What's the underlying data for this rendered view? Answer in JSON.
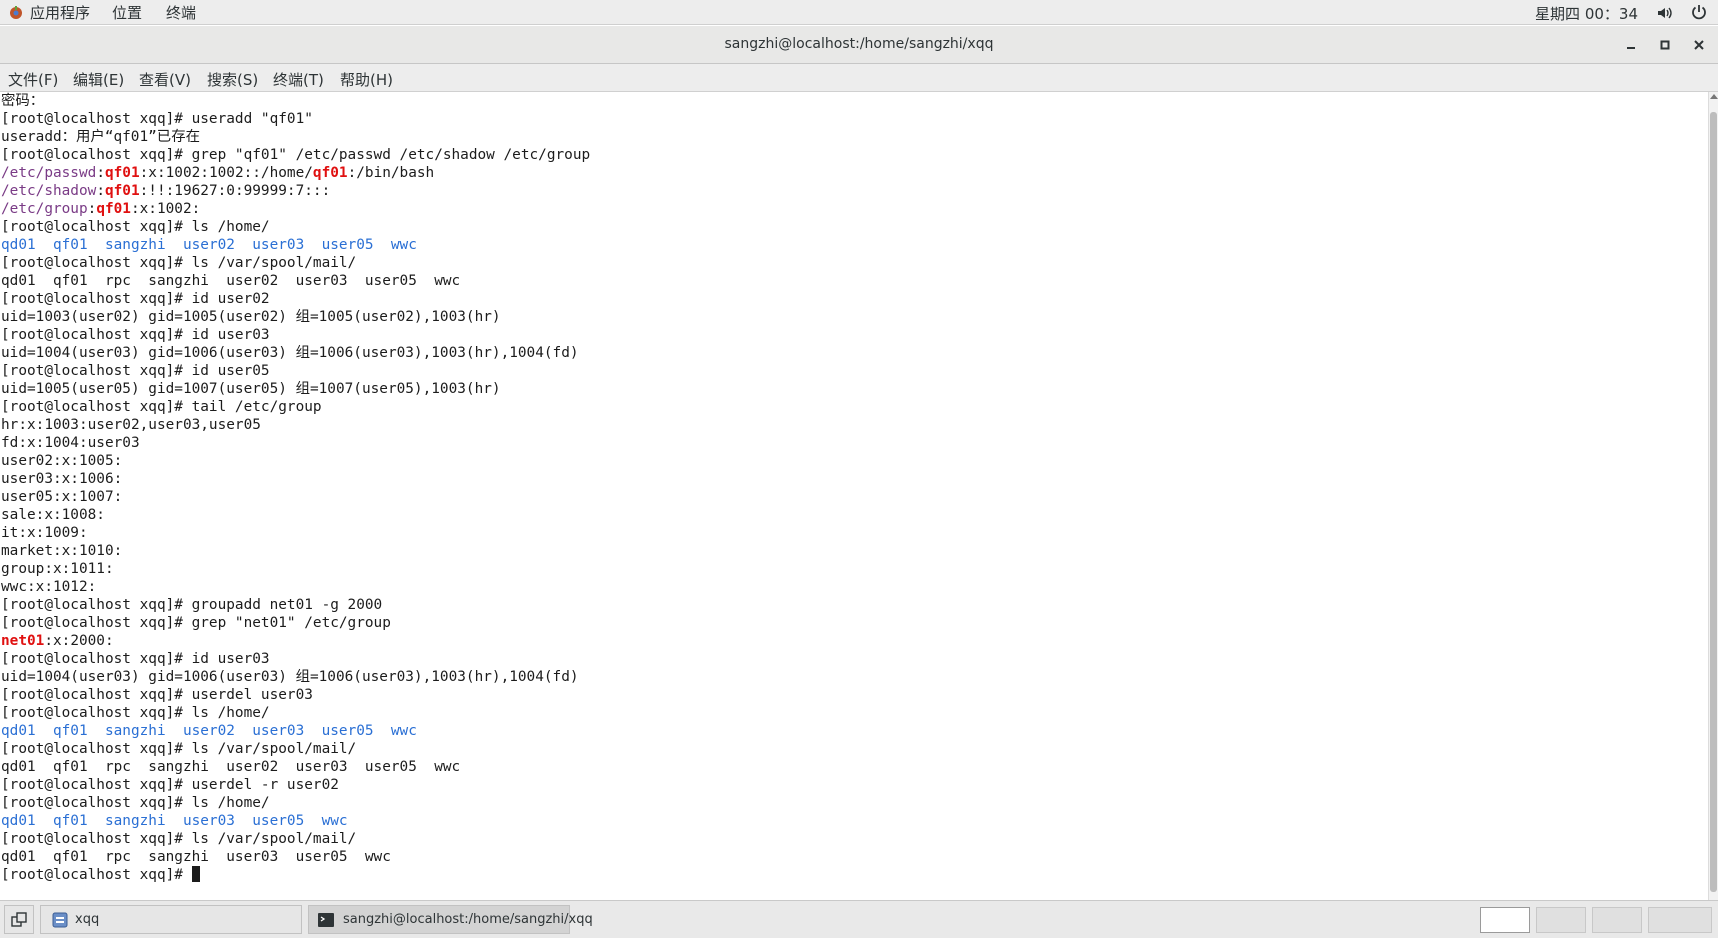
{
  "topbar": {
    "menus": [
      "应用程序",
      "位置",
      "终端"
    ],
    "clock": "星期四 00：34",
    "icons": [
      "apps-icon",
      "volume-icon",
      "power-icon"
    ]
  },
  "window": {
    "title": "sangzhi@localhost:/home/sangzhi/xqq",
    "controls": [
      "minimize-icon",
      "maximize-icon",
      "close-icon"
    ]
  },
  "menubar": [
    "文件(F)",
    "编辑(E)",
    "查看(V)",
    "搜索(S)",
    "终端(T)",
    "帮助(H)"
  ],
  "terminal": {
    "colors": {
      "directory": "#2a6fd4",
      "filename": "#7a3b86",
      "match": "#e01010"
    },
    "lines": [
      [
        {
          "t": "密码："
        }
      ],
      [
        {
          "t": "[root@localhost xqq]# useradd \"qf01\""
        }
      ],
      [
        {
          "t": "useradd：用户“qf01”已存在"
        }
      ],
      [
        {
          "t": "[root@localhost xqq]# grep \"qf01\" /etc/passwd /etc/shadow /etc/group"
        }
      ],
      [
        {
          "t": "/etc/passwd",
          "c": "purple"
        },
        {
          "t": ":"
        },
        {
          "t": "qf01",
          "c": "red"
        },
        {
          "t": ":x:1002:1002::/home/"
        },
        {
          "t": "qf01",
          "c": "red"
        },
        {
          "t": ":/bin/bash"
        }
      ],
      [
        {
          "t": "/etc/shadow",
          "c": "purple"
        },
        {
          "t": ":"
        },
        {
          "t": "qf01",
          "c": "red"
        },
        {
          "t": ":!!:19627:0:99999:7:::"
        }
      ],
      [
        {
          "t": "/etc/group",
          "c": "purple"
        },
        {
          "t": ":"
        },
        {
          "t": "qf01",
          "c": "red"
        },
        {
          "t": ":x:1002:"
        }
      ],
      [
        {
          "t": "[root@localhost xqq]# ls /home/"
        }
      ],
      [
        {
          "t": "qd01",
          "c": "dir"
        },
        {
          "t": "  "
        },
        {
          "t": "qf01",
          "c": "dir"
        },
        {
          "t": "  "
        },
        {
          "t": "sangzhi",
          "c": "dir"
        },
        {
          "t": "  "
        },
        {
          "t": "user02",
          "c": "dir"
        },
        {
          "t": "  "
        },
        {
          "t": "user03",
          "c": "dir"
        },
        {
          "t": "  "
        },
        {
          "t": "user05",
          "c": "dir"
        },
        {
          "t": "  "
        },
        {
          "t": "wwc",
          "c": "dir"
        }
      ],
      [
        {
          "t": "[root@localhost xqq]# ls /var/spool/mail/"
        }
      ],
      [
        {
          "t": "qd01  qf01  rpc  sangzhi  user02  user03  user05  wwc"
        }
      ],
      [
        {
          "t": "[root@localhost xqq]# id user02"
        }
      ],
      [
        {
          "t": "uid=1003(user02) gid=1005(user02) 组=1005(user02),1003(hr)"
        }
      ],
      [
        {
          "t": "[root@localhost xqq]# id user03"
        }
      ],
      [
        {
          "t": "uid=1004(user03) gid=1006(user03) 组=1006(user03),1003(hr),1004(fd)"
        }
      ],
      [
        {
          "t": "[root@localhost xqq]# id user05"
        }
      ],
      [
        {
          "t": "uid=1005(user05) gid=1007(user05) 组=1007(user05),1003(hr)"
        }
      ],
      [
        {
          "t": "[root@localhost xqq]# tail /etc/group"
        }
      ],
      [
        {
          "t": "hr:x:1003:user02,user03,user05"
        }
      ],
      [
        {
          "t": "fd:x:1004:user03"
        }
      ],
      [
        {
          "t": "user02:x:1005:"
        }
      ],
      [
        {
          "t": "user03:x:1006:"
        }
      ],
      [
        {
          "t": "user05:x:1007:"
        }
      ],
      [
        {
          "t": "sale:x:1008:"
        }
      ],
      [
        {
          "t": "it:x:1009:"
        }
      ],
      [
        {
          "t": "market:x:1010:"
        }
      ],
      [
        {
          "t": "group:x:1011:"
        }
      ],
      [
        {
          "t": "wwc:x:1012:"
        }
      ],
      [
        {
          "t": "[root@localhost xqq]# groupadd net01 -g 2000"
        }
      ],
      [
        {
          "t": "[root@localhost xqq]# grep \"net01\" /etc/group"
        }
      ],
      [
        {
          "t": "net01",
          "c": "red"
        },
        {
          "t": ":x:2000:"
        }
      ],
      [
        {
          "t": "[root@localhost xqq]# id user03"
        }
      ],
      [
        {
          "t": "uid=1004(user03) gid=1006(user03) 组=1006(user03),1003(hr),1004(fd)"
        }
      ],
      [
        {
          "t": "[root@localhost xqq]# userdel user03"
        }
      ],
      [
        {
          "t": "[root@localhost xqq]# ls /home/"
        }
      ],
      [
        {
          "t": "qd01",
          "c": "dir"
        },
        {
          "t": "  "
        },
        {
          "t": "qf01",
          "c": "dir"
        },
        {
          "t": "  "
        },
        {
          "t": "sangzhi",
          "c": "dir"
        },
        {
          "t": "  "
        },
        {
          "t": "user02",
          "c": "dir"
        },
        {
          "t": "  "
        },
        {
          "t": "user03",
          "c": "dir"
        },
        {
          "t": "  "
        },
        {
          "t": "user05",
          "c": "dir"
        },
        {
          "t": "  "
        },
        {
          "t": "wwc",
          "c": "dir"
        }
      ],
      [
        {
          "t": "[root@localhost xqq]# ls /var/spool/mail/"
        }
      ],
      [
        {
          "t": "qd01  qf01  rpc  sangzhi  user02  user03  user05  wwc"
        }
      ],
      [
        {
          "t": "[root@localhost xqq]# userdel -r user02"
        }
      ],
      [
        {
          "t": "[root@localhost xqq]# ls /home/"
        }
      ],
      [
        {
          "t": "qd01",
          "c": "dir"
        },
        {
          "t": "  "
        },
        {
          "t": "qf01",
          "c": "dir"
        },
        {
          "t": "  "
        },
        {
          "t": "sangzhi",
          "c": "dir"
        },
        {
          "t": "  "
        },
        {
          "t": "user03",
          "c": "dir"
        },
        {
          "t": "  "
        },
        {
          "t": "user05",
          "c": "dir"
        },
        {
          "t": "  "
        },
        {
          "t": "wwc",
          "c": "dir"
        }
      ],
      [
        {
          "t": "[root@localhost xqq]# ls /var/spool/mail/"
        }
      ],
      [
        {
          "t": "qd01  qf01  rpc  sangzhi  user03  user05  wwc"
        }
      ],
      [
        {
          "t": "[root@localhost xqq]# "
        }
      ]
    ]
  },
  "taskbar": {
    "items": [
      {
        "label": "xqq",
        "icon": "file-manager-icon"
      },
      {
        "label": "sangzhi@localhost:/home/sangzhi/xqq",
        "icon": "terminal-icon"
      }
    ],
    "workspaces": 4
  }
}
